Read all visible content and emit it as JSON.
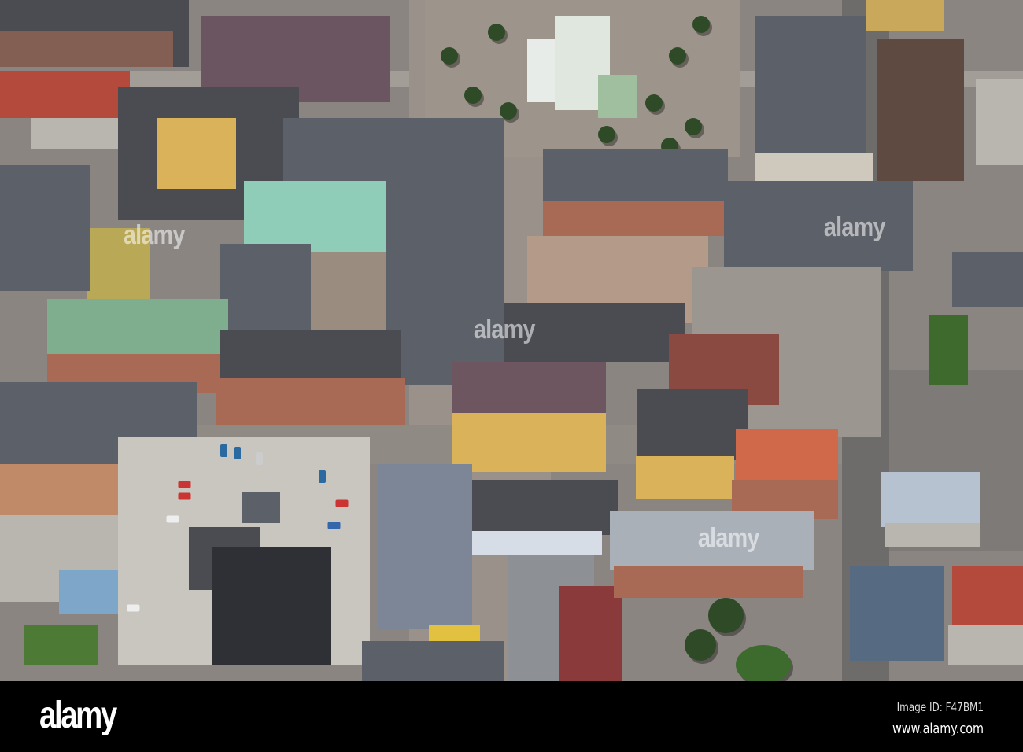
{
  "photo": {
    "subject": "aerial-town-center",
    "watermarks": [
      "alamy",
      "alamy",
      "alamy",
      "alamy"
    ]
  },
  "footer": {
    "logo": "alamy",
    "image_id": "Image ID: F47BM1",
    "website": "www.alamy.com"
  }
}
